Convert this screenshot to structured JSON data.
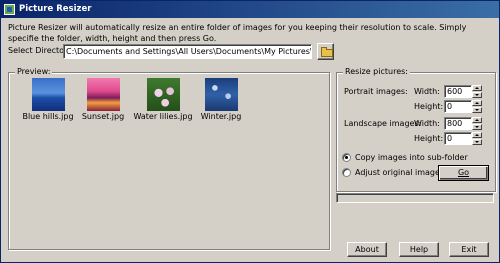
{
  "window": {
    "title": "Picture Resizer"
  },
  "description": "Picture Resizer will automatically resize an entire folder of images for you keeping their resolution to scale. Simply specifie the folder, width, height and then press Go.",
  "directory": {
    "label": "Select Directory:",
    "value": "C:\\Documents and Settings\\All Users\\Documents\\My Pictures\\Sample Pictures"
  },
  "preview": {
    "title": "Preview:",
    "items": [
      {
        "name": "Blue hills.jpg"
      },
      {
        "name": "Sunset.jpg"
      },
      {
        "name": "Water lilies.jpg"
      },
      {
        "name": "Winter.jpg"
      }
    ]
  },
  "resize": {
    "title": "Resize pictures:",
    "portrait_label": "Portrait images:",
    "landscape_label": "Landscape images:",
    "width_label": "Width:",
    "height_label": "Height:",
    "portrait_width": "600",
    "portrait_height": "0",
    "landscape_width": "800",
    "landscape_height": "0",
    "option_copy": "Copy images into sub-folder",
    "option_adjust": "Adjust original images",
    "selected_option": "copy",
    "go_label": "Go"
  },
  "buttons": {
    "about": "About",
    "help": "Help",
    "exit": "Exit"
  }
}
